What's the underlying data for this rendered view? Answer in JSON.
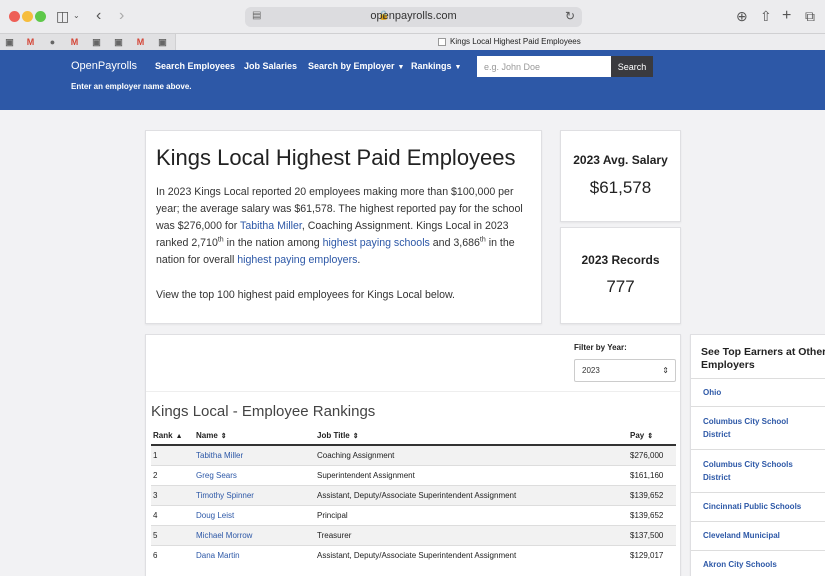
{
  "browser": {
    "url": "openpayrolls.com",
    "tab_title": "Kings Local Highest Paid Employees",
    "favicon_labels": [
      "M",
      "M",
      "M"
    ]
  },
  "nav": {
    "brand": "OpenPayrolls",
    "links": [
      "Search Employees",
      "Job Salaries",
      "Search by Employer",
      "Rankings"
    ],
    "search_placeholder": "e.g. John Doe",
    "search_button": "Search",
    "hint": "Enter an employer name above."
  },
  "intro": {
    "title": "Kings Local Highest Paid Employees",
    "text_1": "In 2023 Kings Local reported 20 employees making more than $100,000 per",
    "text_2": "year; the average salary was $61,578. The highest reported pay for the school",
    "text_3a": "was $276,000 for ",
    "text_3_link": "Tabitha Miller",
    "text_3b": ", Coaching Assignment. Kings Local in 2023",
    "text_4a": "ranked 2,710",
    "text_4_sup1": "th",
    "text_4b": " in the nation among ",
    "text_4_link": "highest paying schools",
    "text_4c": " and 3,686",
    "text_4_sup2": "th",
    "text_4d": " in the",
    "text_5a": "nation for overall ",
    "text_5_link": "highest paying employers",
    "text_5b": ".",
    "text_6": "View the top 100 highest paid employees for Kings Local below."
  },
  "stats": {
    "avg_label": "2023 Avg. Salary",
    "avg_value": "$61,578",
    "records_label": "2023 Records",
    "records_value": "777"
  },
  "rankings": {
    "filter_label": "Filter by Year:",
    "filter_value": "2023",
    "title": "Kings Local - Employee Rankings",
    "columns": [
      "Rank",
      "Name",
      "Job Title",
      "Pay"
    ],
    "rows": [
      {
        "rank": "1",
        "name": "Tabitha Miller",
        "title": "Coaching Assignment",
        "pay": "$276,000"
      },
      {
        "rank": "2",
        "name": "Greg Sears",
        "title": "Superintendent Assignment",
        "pay": "$161,160"
      },
      {
        "rank": "3",
        "name": "Timothy Spinner",
        "title": "Assistant, Deputy/Associate Superintendent Assignment",
        "pay": "$139,652"
      },
      {
        "rank": "4",
        "name": "Doug Leist",
        "title": "Principal",
        "pay": "$139,652"
      },
      {
        "rank": "5",
        "name": "Michael Morrow",
        "title": "Treasurer",
        "pay": "$137,500"
      },
      {
        "rank": "6",
        "name": "Dana Martin",
        "title": "Assistant, Deputy/Associate Superintendent Assignment",
        "pay": "$129,017"
      }
    ]
  },
  "sidebar": {
    "title": "See Top Earners at Other Employers",
    "items": [
      "Ohio",
      "Columbus City School District",
      "Columbus City Schools District",
      "Cincinnati Public Schools",
      "Cleveland Municipal",
      "Akron City Schools"
    ]
  }
}
